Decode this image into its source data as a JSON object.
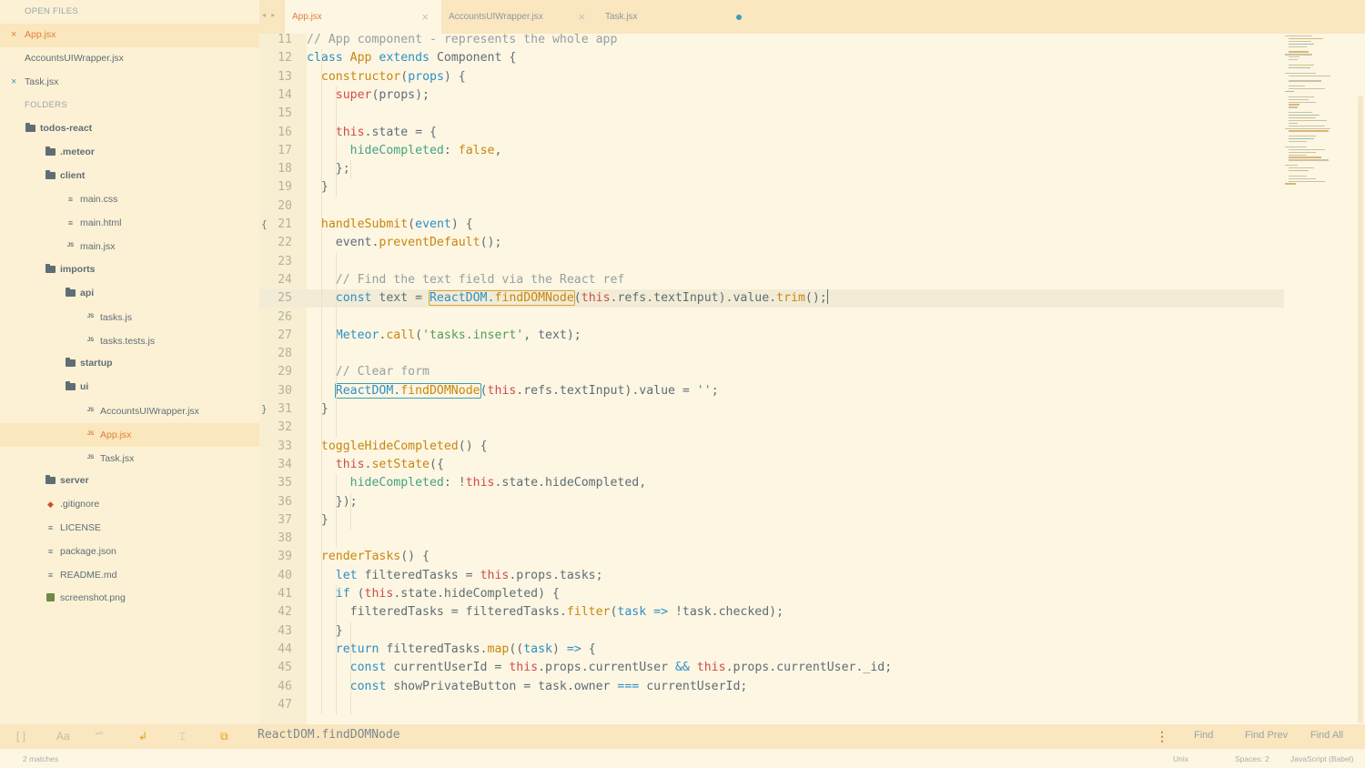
{
  "sidebar": {
    "open_files_header": "OPEN FILES",
    "open_files": [
      {
        "name": "App.jsx",
        "active": true,
        "close": "×"
      },
      {
        "name": "AccountsUIWrapper.jsx",
        "active": false,
        "close": ""
      },
      {
        "name": "Task.jsx",
        "active": false,
        "close": "×"
      }
    ],
    "folders_header": "FOLDERS",
    "tree": [
      {
        "name": "todos-react",
        "depth": 0,
        "type": "folder"
      },
      {
        "name": ".meteor",
        "depth": 1,
        "type": "folder"
      },
      {
        "name": "client",
        "depth": 1,
        "type": "folder"
      },
      {
        "name": "main.css",
        "depth": 2,
        "type": "file"
      },
      {
        "name": "main.html",
        "depth": 2,
        "type": "file"
      },
      {
        "name": "main.jsx",
        "depth": 2,
        "type": "js"
      },
      {
        "name": "imports",
        "depth": 1,
        "type": "folder"
      },
      {
        "name": "api",
        "depth": 2,
        "type": "folder"
      },
      {
        "name": "tasks.js",
        "depth": 3,
        "type": "js"
      },
      {
        "name": "tasks.tests.js",
        "depth": 3,
        "type": "js"
      },
      {
        "name": "startup",
        "depth": 2,
        "type": "folder"
      },
      {
        "name": "ui",
        "depth": 2,
        "type": "folder"
      },
      {
        "name": "AccountsUIWrapper.jsx",
        "depth": 3,
        "type": "js"
      },
      {
        "name": "App.jsx",
        "depth": 3,
        "type": "js",
        "active": true
      },
      {
        "name": "Task.jsx",
        "depth": 3,
        "type": "js"
      },
      {
        "name": "server",
        "depth": 1,
        "type": "folder"
      },
      {
        "name": ".gitignore",
        "depth": 1,
        "type": "git"
      },
      {
        "name": "LICENSE",
        "depth": 1,
        "type": "file"
      },
      {
        "name": "package.json",
        "depth": 1,
        "type": "file"
      },
      {
        "name": "README.md",
        "depth": 1,
        "type": "file"
      },
      {
        "name": "screenshot.png",
        "depth": 1,
        "type": "img"
      }
    ]
  },
  "tabs": [
    {
      "label": "App.jsx",
      "active": true
    },
    {
      "label": "AccountsUIWrapper.jsx",
      "active": false
    },
    {
      "label": "Task.jsx",
      "active": false,
      "modified": true
    }
  ],
  "tab_nav": "◂ ▸",
  "editor": {
    "current_line": 25,
    "lines": [
      {
        "n": "11",
        "t": [
          [
            "c-com",
            "// App component - represents the whole app"
          ]
        ]
      },
      {
        "n": "12",
        "t": [
          [
            "c-kw",
            "class "
          ],
          [
            "c-cls",
            "App "
          ],
          [
            "c-kw",
            "extends "
          ],
          [
            "",
            "Component {"
          ]
        ]
      },
      {
        "n": "13",
        "t": [
          [
            "",
            "  "
          ],
          [
            "c-fn",
            "constructor"
          ],
          [
            "",
            "("
          ],
          [
            "c-par",
            "props"
          ],
          [
            "",
            ") {"
          ]
        ]
      },
      {
        "n": "14",
        "t": [
          [
            "",
            "    "
          ],
          [
            "c-this",
            "super"
          ],
          [
            "",
            "(props);"
          ]
        ]
      },
      {
        "n": "15",
        "t": []
      },
      {
        "n": "16",
        "t": [
          [
            "",
            "    "
          ],
          [
            "c-this",
            "this"
          ],
          [
            "",
            ".state = {"
          ]
        ]
      },
      {
        "n": "17",
        "t": [
          [
            "",
            "      "
          ],
          [
            "c-prop",
            "hideCompleted"
          ],
          [
            "",
            ": "
          ],
          [
            "c-bool",
            "false"
          ],
          [
            "",
            ","
          ]
        ]
      },
      {
        "n": "18",
        "t": [
          [
            "",
            "    };"
          ]
        ]
      },
      {
        "n": "19",
        "t": [
          [
            "",
            "  }"
          ]
        ]
      },
      {
        "n": "20",
        "t": []
      },
      {
        "n": "21",
        "fold": "{",
        "t": [
          [
            "",
            "  "
          ],
          [
            "c-fn",
            "handleSubmit"
          ],
          [
            "",
            "("
          ],
          [
            "c-par",
            "event"
          ],
          [
            "",
            ") {"
          ]
        ]
      },
      {
        "n": "22",
        "t": [
          [
            "",
            "    event."
          ],
          [
            "c-fn",
            "preventDefault"
          ],
          [
            "",
            "();"
          ]
        ]
      },
      {
        "n": "23",
        "t": []
      },
      {
        "n": "24",
        "t": [
          [
            "",
            "    "
          ],
          [
            "c-com",
            "// Find the text field via the React ref"
          ]
        ]
      },
      {
        "n": "25",
        "t": [
          [
            "",
            "    "
          ],
          [
            "c-kw",
            "const "
          ],
          [
            "",
            "text = "
          ],
          [
            "hl c-kw",
            "ReactDOM."
          ],
          [
            "hlfn c-fn",
            "findDOMNode"
          ],
          [
            "",
            "("
          ],
          [
            "c-this",
            "this"
          ],
          [
            "",
            ".refs.textInput).value."
          ],
          [
            "c-fn",
            "trim"
          ],
          [
            "",
            "();"
          ],
          [
            "cursor",
            ""
          ]
        ]
      },
      {
        "n": "26",
        "t": []
      },
      {
        "n": "27",
        "t": [
          [
            "",
            "    "
          ],
          [
            "c-kw",
            "Meteor"
          ],
          [
            "",
            "."
          ],
          [
            "c-fn",
            "call"
          ],
          [
            "",
            "("
          ],
          [
            "c-str",
            "'tasks.insert'"
          ],
          [
            "",
            ", text);"
          ]
        ]
      },
      {
        "n": "28",
        "t": []
      },
      {
        "n": "29",
        "t": [
          [
            "",
            "    "
          ],
          [
            "c-com",
            "// Clear form"
          ]
        ]
      },
      {
        "n": "30",
        "t": [
          [
            "",
            "    "
          ],
          [
            "hlb c-kw",
            "ReactDOM."
          ],
          [
            "hlbfn c-fn",
            "findDOMNode"
          ],
          [
            "",
            "("
          ],
          [
            "c-this",
            "this"
          ],
          [
            "",
            ".refs.textInput).value = "
          ],
          [
            "c-str",
            "''"
          ],
          [
            "",
            ";"
          ]
        ]
      },
      {
        "n": "31",
        "fold": "}",
        "t": [
          [
            "",
            "  }"
          ]
        ]
      },
      {
        "n": "32",
        "t": []
      },
      {
        "n": "33",
        "t": [
          [
            "",
            "  "
          ],
          [
            "c-fn",
            "toggleHideCompleted"
          ],
          [
            "",
            "() {"
          ]
        ]
      },
      {
        "n": "34",
        "t": [
          [
            "",
            "    "
          ],
          [
            "c-this",
            "this"
          ],
          [
            "",
            "."
          ],
          [
            "c-fn",
            "setState"
          ],
          [
            "",
            "({"
          ]
        ]
      },
      {
        "n": "35",
        "t": [
          [
            "",
            "      "
          ],
          [
            "c-prop",
            "hideCompleted"
          ],
          [
            "",
            ": !"
          ],
          [
            "c-this",
            "this"
          ],
          [
            "",
            ".state.hideCompleted,"
          ]
        ]
      },
      {
        "n": "36",
        "t": [
          [
            "",
            "    });"
          ]
        ]
      },
      {
        "n": "37",
        "t": [
          [
            "",
            "  }"
          ]
        ]
      },
      {
        "n": "38",
        "t": []
      },
      {
        "n": "39",
        "t": [
          [
            "",
            "  "
          ],
          [
            "c-fn",
            "renderTasks"
          ],
          [
            "",
            "() {"
          ]
        ]
      },
      {
        "n": "40",
        "t": [
          [
            "",
            "    "
          ],
          [
            "c-kw",
            "let "
          ],
          [
            "",
            "filteredTasks = "
          ],
          [
            "c-this",
            "this"
          ],
          [
            "",
            ".props.tasks;"
          ]
        ]
      },
      {
        "n": "41",
        "t": [
          [
            "",
            "    "
          ],
          [
            "c-kw",
            "if "
          ],
          [
            "",
            "("
          ],
          [
            "c-this",
            "this"
          ],
          [
            "",
            ".state.hideCompleted) {"
          ]
        ]
      },
      {
        "n": "42",
        "t": [
          [
            "",
            "      filteredTasks = filteredTasks."
          ],
          [
            "c-fn",
            "filter"
          ],
          [
            "",
            "("
          ],
          [
            "c-par",
            "task"
          ],
          [
            "",
            " "
          ],
          [
            "c-op",
            "=>"
          ],
          [
            "",
            " !task.checked);"
          ]
        ]
      },
      {
        "n": "43",
        "t": [
          [
            "",
            "    }"
          ]
        ]
      },
      {
        "n": "44",
        "t": [
          [
            "",
            "    "
          ],
          [
            "c-kw",
            "return "
          ],
          [
            "",
            "filteredTasks."
          ],
          [
            "c-fn",
            "map"
          ],
          [
            "",
            "(("
          ],
          [
            "c-par",
            "task"
          ],
          [
            "",
            ") "
          ],
          [
            "c-op",
            "=>"
          ],
          [
            "",
            " {"
          ]
        ]
      },
      {
        "n": "45",
        "t": [
          [
            "",
            "      "
          ],
          [
            "c-kw",
            "const "
          ],
          [
            "",
            "currentUserId = "
          ],
          [
            "c-this",
            "this"
          ],
          [
            "",
            ".props.currentUser "
          ],
          [
            "c-op",
            "&&"
          ],
          [
            "",
            " "
          ],
          [
            "c-this",
            "this"
          ],
          [
            "",
            ".props.currentUser._id;"
          ]
        ]
      },
      {
        "n": "46",
        "t": [
          [
            "",
            "      "
          ],
          [
            "c-kw",
            "const "
          ],
          [
            "",
            "showPrivateButton = task.owner "
          ],
          [
            "c-op",
            "==="
          ],
          [
            "",
            " currentUserId;"
          ]
        ]
      },
      {
        "n": "47",
        "t": []
      }
    ]
  },
  "findbar": {
    "icons": [
      "regex-icon",
      "case-sensitive-icon",
      "whole-word-icon",
      "wrap-icon",
      "in-selection-icon",
      "highlight-matches-icon"
    ],
    "icon_glyphs": [
      "[ ]",
      "Aa",
      "“”",
      "↲",
      "⌶",
      "⧉"
    ],
    "query": "ReactDOM.findDOMNode",
    "options_glyph": "⋮",
    "find": "Find",
    "find_prev": "Find Prev",
    "find_all": "Find All"
  },
  "status": {
    "matches": "2 matches",
    "line_endings": "Unix",
    "indent": "Spaces: 2",
    "syntax": "JavaScript (Babel)"
  },
  "colors": {
    "accent": "#e07f3a",
    "background": "#fdf6e3",
    "sidebar": "#fcf1d5"
  }
}
